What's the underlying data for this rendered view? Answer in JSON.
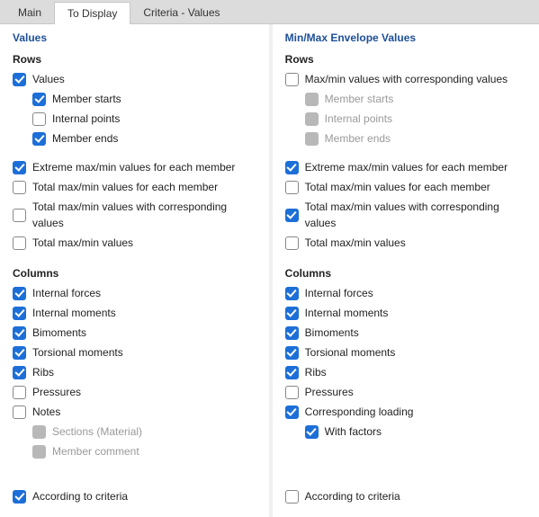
{
  "tabs": {
    "main": "Main",
    "to_display": "To Display",
    "criteria": "Criteria - Values"
  },
  "active_tab": "to_display",
  "left": {
    "title": "Values",
    "rows_label": "Rows",
    "columns_label": "Columns",
    "items": {
      "values": "Values",
      "member_starts": "Member starts",
      "internal_points": "Internal points",
      "member_ends": "Member ends",
      "extreme_each": "Extreme max/min values for each member",
      "total_each": "Total max/min values for each member",
      "total_corresponding": "Total max/min values with corresponding values",
      "total_values": "Total max/min values",
      "col_internal_forces": "Internal forces",
      "col_internal_moments": "Internal moments",
      "col_bimoments": "Bimoments",
      "col_torsional": "Torsional moments",
      "col_ribs": "Ribs",
      "col_pressures": "Pressures",
      "col_notes": "Notes",
      "col_sections": "Sections (Material)",
      "col_member_comment": "Member comment",
      "according": "According to criteria"
    }
  },
  "right": {
    "title": "Min/Max Envelope Values",
    "rows_label": "Rows",
    "columns_label": "Columns",
    "items": {
      "maxmin_with_corr": "Max/min values with corresponding values",
      "member_starts": "Member starts",
      "internal_points": "Internal points",
      "member_ends": "Member ends",
      "extreme_each": "Extreme max/min values for each member",
      "total_each": "Total max/min values for each member",
      "total_corresponding": "Total max/min values with corresponding values",
      "total_values": "Total max/min values",
      "col_internal_forces": "Internal forces",
      "col_internal_moments": "Internal moments",
      "col_bimoments": "Bimoments",
      "col_torsional": "Torsional moments",
      "col_ribs": "Ribs",
      "col_pressures": "Pressures",
      "col_corr_loading": "Corresponding loading",
      "col_with_factors": "With factors",
      "according": "According to criteria"
    }
  }
}
